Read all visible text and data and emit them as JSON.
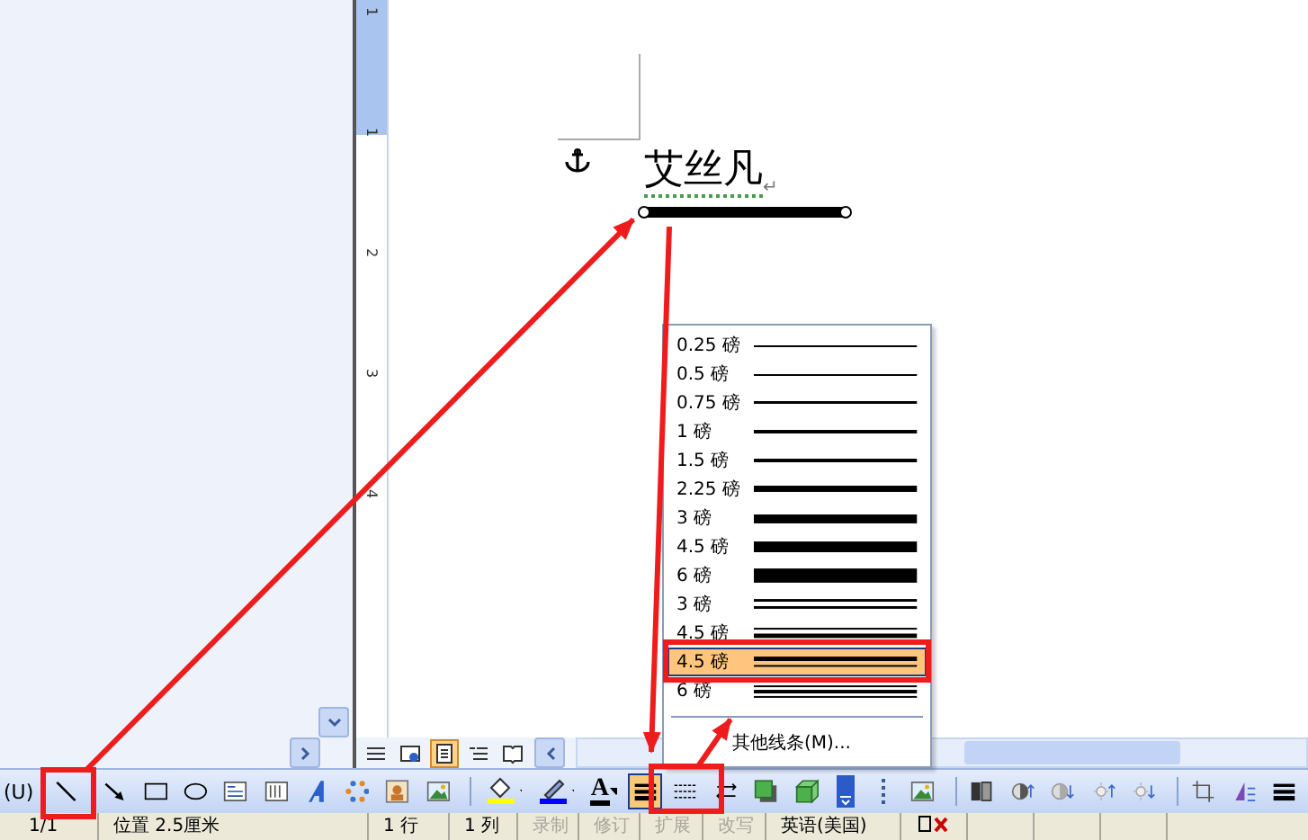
{
  "ruler": {
    "numbers": [
      "1",
      "1",
      "2",
      "3",
      "4"
    ]
  },
  "document": {
    "paragraph": "艾丝凡",
    "paragraph_mark": "↵"
  },
  "view_buttons": [
    {
      "kind": "normal",
      "selected": false
    },
    {
      "kind": "web",
      "selected": false
    },
    {
      "kind": "print",
      "selected": true
    },
    {
      "kind": "outline",
      "selected": false
    },
    {
      "kind": "reading",
      "selected": false
    }
  ],
  "line_menu": {
    "items": [
      {
        "label": "0.25 磅",
        "kind": "single",
        "selected": false
      },
      {
        "label": "0.5 磅",
        "kind": "single",
        "selected": false
      },
      {
        "label": "0.75 磅",
        "kind": "single",
        "selected": false
      },
      {
        "label": "1 磅",
        "kind": "single",
        "selected": false
      },
      {
        "label": "1.5 磅",
        "kind": "single",
        "selected": false
      },
      {
        "label": "2.25 磅",
        "kind": "single",
        "selected": false
      },
      {
        "label": "3 磅",
        "kind": "single",
        "selected": false
      },
      {
        "label": "4.5 磅",
        "kind": "single",
        "selected": false
      },
      {
        "label": "6 磅",
        "kind": "single",
        "selected": false
      },
      {
        "label": "3 磅",
        "kind": "double",
        "selected": false
      },
      {
        "label": "4.5 磅",
        "kind": "thin-thick",
        "selected": false
      },
      {
        "label": "4.5 磅",
        "kind": "thick-thin",
        "selected": true
      },
      {
        "label": "6 磅",
        "kind": "triple",
        "selected": false
      }
    ],
    "more": "其他线条(M)..."
  },
  "drawing_toolbar": {
    "label": "(U)",
    "font_color_letter": "A",
    "items": [
      {
        "kind": "line",
        "selected": false
      },
      {
        "kind": "arrow",
        "selected": false
      },
      {
        "kind": "rectangle",
        "selected": false
      },
      {
        "kind": "oval",
        "selected": false
      },
      {
        "kind": "textbox",
        "selected": false
      },
      {
        "kind": "vertical-textbox",
        "selected": false
      },
      {
        "kind": "wordart",
        "selected": false
      },
      {
        "kind": "diagram",
        "selected": false
      },
      {
        "kind": "clipart",
        "selected": false
      },
      {
        "kind": "picture",
        "selected": false
      },
      {
        "kind": "separator"
      },
      {
        "kind": "fill-color",
        "selected": false
      },
      {
        "kind": "line-color",
        "selected": false
      },
      {
        "kind": "font-color",
        "selected": false
      },
      {
        "kind": "line-style",
        "selected": true
      },
      {
        "kind": "dash-style",
        "selected": false
      },
      {
        "kind": "arrow-style",
        "selected": false
      },
      {
        "kind": "shadow",
        "selected": false
      },
      {
        "kind": "cube",
        "selected": false
      },
      {
        "kind": "overflow",
        "selected": false
      },
      {
        "kind": "grip",
        "selected": false
      },
      {
        "kind": "picture",
        "selected": false
      },
      {
        "kind": "separator"
      },
      {
        "kind": "color",
        "selected": false
      },
      {
        "kind": "contrast-up",
        "selected": false
      },
      {
        "kind": "contrast-down",
        "selected": false
      },
      {
        "kind": "brightness-up",
        "selected": false
      },
      {
        "kind": "brightness-down",
        "selected": false
      },
      {
        "kind": "separator"
      },
      {
        "kind": "crop",
        "selected": false
      },
      {
        "kind": "rotate",
        "selected": false
      },
      {
        "kind": "line-style",
        "selected": false
      }
    ]
  },
  "status_bar": {
    "items": [
      {
        "text": "1/1",
        "disabled": false
      },
      {
        "text": "位置 2.5厘米",
        "disabled": false
      },
      {
        "text": "1 行",
        "disabled": false
      },
      {
        "text": "1 列",
        "disabled": false
      },
      {
        "text": "录制",
        "disabled": true
      },
      {
        "text": "修订",
        "disabled": true
      },
      {
        "text": "扩展",
        "disabled": true
      },
      {
        "text": "改写",
        "disabled": true
      },
      {
        "text": "英语(美国)",
        "disabled": false
      }
    ]
  }
}
